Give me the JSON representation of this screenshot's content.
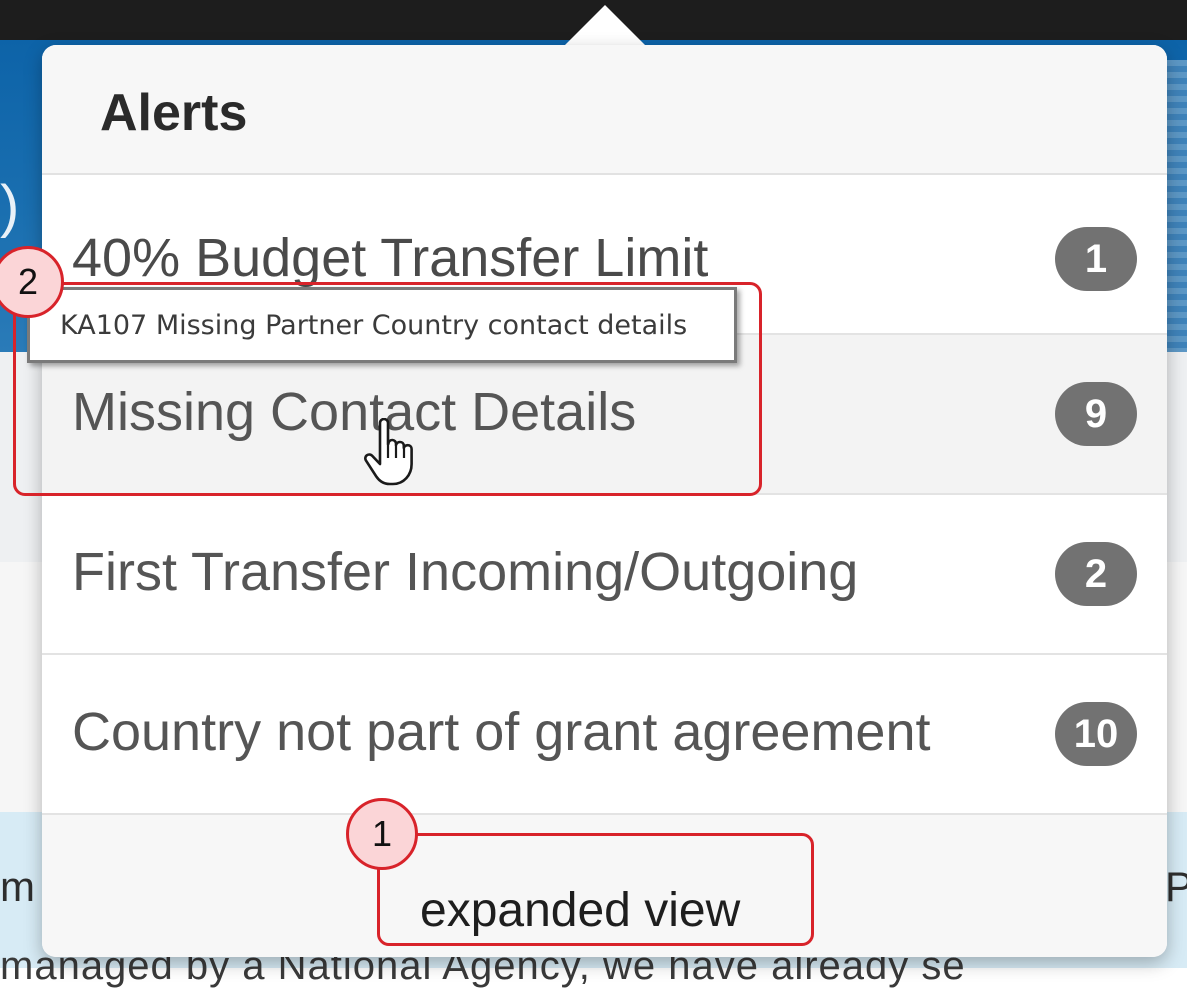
{
  "background": {
    "paren_text": ")",
    "left_fragment": "m",
    "right_fragment": "P",
    "bottom_fragment": "managed by a National Agency, we have already se"
  },
  "popover": {
    "title": "Alerts",
    "alerts": [
      {
        "label": "40% Budget Transfer Limit",
        "count": "1"
      },
      {
        "label": "Missing Contact Details",
        "count": "9"
      },
      {
        "label": "First Transfer Incoming/Outgoing",
        "count": "2"
      },
      {
        "label": "Country not part of grant agreement",
        "count": "10"
      }
    ],
    "footer_link": "expanded view"
  },
  "tooltip": {
    "text": "KA107 Missing Partner Country contact details"
  },
  "callouts": [
    {
      "number": "1"
    },
    {
      "number": "2"
    }
  ],
  "colors": {
    "highlight_red": "#d8232a",
    "badge_gray": "#727272",
    "header_blue": "#0d63a8"
  },
  "icons": {
    "cursor": "hand-pointer-icon"
  }
}
